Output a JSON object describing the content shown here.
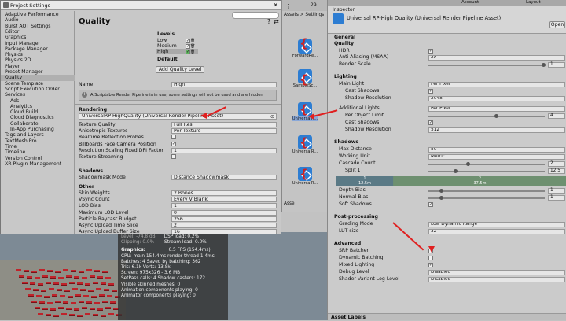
{
  "project_settings": {
    "title": "Project Settings",
    "nav": [
      "Adaptive Performance",
      "Audio",
      "Burst AOT Settings",
      "Editor",
      "Graphics",
      "Input Manager",
      "Package Manager",
      "Physics",
      "Physics 2D",
      "Player",
      "Preset Manager",
      "Quality",
      "Scene Template",
      "Script Execution Order",
      "Services",
      "Ads",
      "Analytics",
      "Cloud Build",
      "Cloud Diagnostics",
      "Collaborate",
      "In-App Purchasing",
      "Tags and Layers",
      "TextMesh Pro",
      "Time",
      "Timeline",
      "Version Control",
      "XR Plugin Management"
    ],
    "heading": "Quality",
    "levels_label": "Levels",
    "levels": [
      "Low",
      "Medium",
      "High"
    ],
    "default_label": "Default",
    "add_quality_level": "Add Quality Level",
    "name_label": "Name",
    "name_value": "High",
    "info_text": "A Scriptable Render Pipeline is in use, some settings will not be used and are hidden",
    "rendering_section": "Rendering",
    "pipeline_asset": "UniversalRP-HighQuality (Universal Render Pipeline Asset)",
    "rows": [
      {
        "label": "Texture Quality",
        "value": "Full Res"
      },
      {
        "label": "Anisotropic Textures",
        "value": "Per Texture"
      },
      {
        "label": "Realtime Reflection Probes",
        "value": ""
      },
      {
        "label": "Billboards Face Camera Position",
        "value": ""
      },
      {
        "label": "Resolution Scaling Fixed DPI Factor",
        "value": "1"
      },
      {
        "label": "Texture Streaming",
        "value": ""
      }
    ],
    "shadows_section": "Shadows",
    "shadowmask_label": "Shadowmask Mode",
    "shadowmask_value": "Distance Shadowmask",
    "other_section": "Other",
    "other_rows": [
      {
        "label": "Skin Weights",
        "value": "2 Bones"
      },
      {
        "label": "VSync Count",
        "value": "Every V Blank"
      },
      {
        "label": "LOD Bias",
        "value": "1"
      },
      {
        "label": "Maximum LOD Level",
        "value": "0"
      },
      {
        "label": "Particle Raycast Budget",
        "value": "256"
      },
      {
        "label": "Async Upload Time Slice",
        "value": "2"
      },
      {
        "label": "Async Upload Buffer Size",
        "value": "16"
      }
    ]
  },
  "project_panel": {
    "count": "29",
    "breadcrumb": "Assets > Settings",
    "assets": [
      "ForwardRe...",
      "SampleSc...",
      "UniversalR...",
      "UniversalR...",
      "UniversalR..."
    ],
    "footer": "Asse"
  },
  "stats": {
    "top1": "Level: -74.8 dB",
    "top2": "Clipping: 0.0%",
    "dsp": "DSP load: 0.2%",
    "stream": "Stream load: 0.0%",
    "graphics_label": "Graphics:",
    "fps": "6.5 FPS (154.4ms)",
    "lines": [
      "CPU: main 154.4ms  render thread 1.4ms",
      "Batches: 4        Saved by batching: 362",
      "Tris: 6.1k        Verts: 13.8k",
      "Screen: 975x326 - 3.6 MB",
      "SetPass calls: 4     Shadow casters: 172",
      "Visible skinned meshes: 0",
      "Animation components playing: 0",
      "Animator components playing: 0"
    ]
  },
  "inspector": {
    "tab": "Inspector",
    "account": "Account",
    "layout": "Layout",
    "asset_title": "Universal RP-High Quality (Universal Render Pipeline Asset)",
    "open_button": "Open",
    "general": "General",
    "quality": "Quality",
    "hdr": "HDR",
    "aa_label": "Anti Aliasing (MSAA)",
    "aa_value": "2x",
    "render_scale_label": "Render Scale",
    "render_scale_value": "1",
    "lighting": "Lighting",
    "main_light_label": "Main Light",
    "main_light_value": "Per Pixel",
    "cast_shadows": "Cast Shadows",
    "shadow_res_label": "Shadow Resolution",
    "shadow_res_value": "2048",
    "additional_lights_label": "Additional Lights",
    "additional_lights_value": "Per Pixel",
    "per_object_limit_label": "Per Object Limit",
    "per_object_limit_value": "4",
    "add_shadow_res_value": "512",
    "shadows": "Shadows",
    "max_distance_label": "Max Distance",
    "max_distance_value": "50",
    "working_unit_label": "Working Unit",
    "working_unit_value": "Metric",
    "cascade_count_label": "Cascade Count",
    "cascade_count_value": "2",
    "split1_label": "Split 1",
    "split1_value": "12.5",
    "cascade_a_idx": "1",
    "cascade_a_val": "12.5m",
    "cascade_b_idx": "2",
    "cascade_b_val": "37.5m",
    "depth_bias_label": "Depth Bias",
    "depth_bias_value": "1",
    "normal_bias_label": "Normal Bias",
    "normal_bias_value": "1",
    "soft_shadows": "Soft Shadows",
    "post_processing": "Post-processing",
    "grading_mode_label": "Grading Mode",
    "grading_mode_value": "Low Dynamic Range",
    "lut_size_label": "LUT size",
    "lut_size_value": "32",
    "advanced": "Advanced",
    "srp_batcher": "SRP Batcher",
    "dynamic_batching": "Dynamic Batching",
    "mixed_lighting": "Mixed Lighting",
    "debug_level_label": "Debug Level",
    "debug_level_value": "Disabled",
    "shader_variant_label": "Shader Variant Log Level",
    "shader_variant_value": "Disabled",
    "asset_labels": "Asset Labels"
  },
  "colors": {
    "accent_arrow": "#e02020",
    "cascade1": "#5b7a86",
    "cascade2": "#6e9070",
    "asset_icon": "#2d7dd2"
  }
}
